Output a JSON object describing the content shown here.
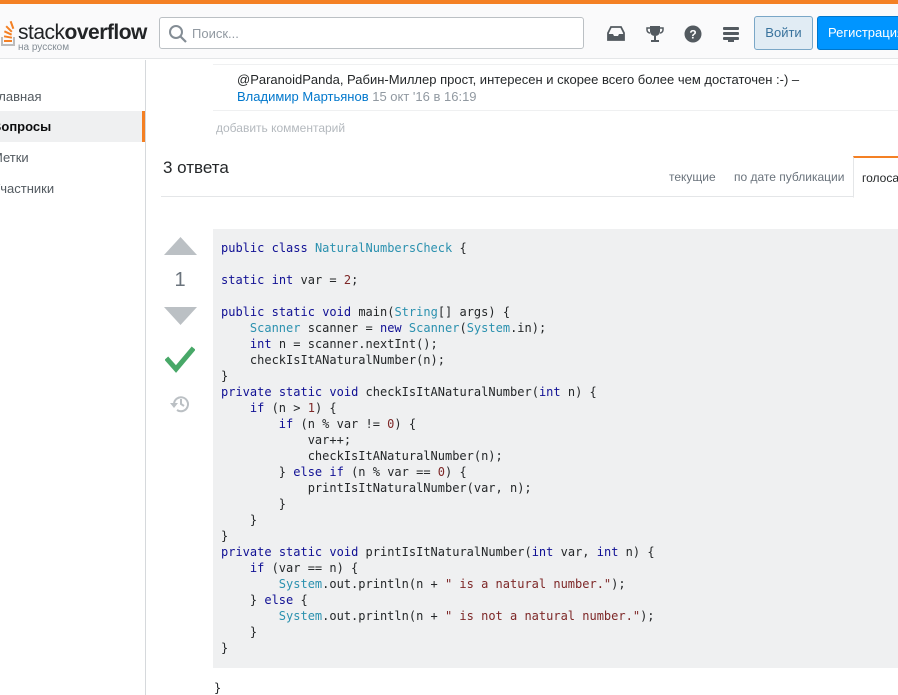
{
  "header": {
    "logo_word_light": "stack",
    "logo_word_bold": "overflow",
    "logo_subtitle": "на русском",
    "search": {
      "placeholder": "Поиск..."
    },
    "login_label": "Войти",
    "signup_label": "Регистрация",
    "icons": [
      "inbox-icon",
      "achievements-icon",
      "help-icon",
      "site-switcher-icon"
    ],
    "accent_color": "#f48024"
  },
  "leftnav": {
    "items": [
      {
        "label": "Главная",
        "active": false
      },
      {
        "label": "Вопросы",
        "active": true
      },
      {
        "label": "Метки",
        "active": false
      },
      {
        "label": "Участники",
        "active": false
      }
    ]
  },
  "comment": {
    "text": "@ParanoidPanda, Рабин-Миллер прост, интересен и скорее всего более чем достаточен :-) –",
    "user": "Владимир Мартьянов",
    "date": "15 окт '16 в 16:19"
  },
  "add_comment_label": "добавить комментарий",
  "answers": {
    "title": "3 ответа",
    "tabs": [
      "текущие",
      "по дате публикации",
      "голоса"
    ],
    "active_tab": "голоса"
  },
  "answer": {
    "votes": "1",
    "accepted": true,
    "closing_brace": "}"
  },
  "code": {
    "lines": [
      "public class NaturalNumbersCheck {",
      "",
      "static int var = 2;",
      "",
      "public static void main(String[] args) {",
      "    Scanner scanner = new Scanner(System.in);",
      "    int n = scanner.nextInt();",
      "    checkIsItANaturalNumber(n);",
      "}",
      "private static void checkIsItANaturalNumber(int n) {",
      "    if (n > 1) {",
      "        if (n % var != 0) {",
      "            var++;",
      "            checkIsItANaturalNumber(n);",
      "        } else if (n % var == 0) {",
      "            printIsItNaturalNumber(var, n);",
      "        }",
      "    }",
      "}",
      "private static void printIsItNaturalNumber(int var, int n) {",
      "    if (var == n) {",
      "        System.out.println(n + \" is a natural number.\");",
      "    } else {",
      "        System.out.println(n + \" is not a natural number.\");",
      "    }",
      "}"
    ]
  }
}
